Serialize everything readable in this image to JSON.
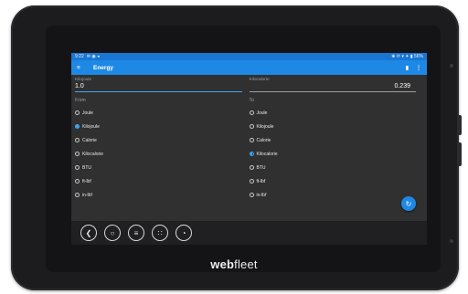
{
  "status": {
    "time": "9:22",
    "left_icons": "✉ ◉ ◂",
    "right_icons": "❀ ⟳ ▾ ✦ ▮ 56%"
  },
  "appbar": {
    "title": "Energy",
    "menu_icon": "≡",
    "action1_icon": "▮",
    "action2_icon": "⋮"
  },
  "input": {
    "unit": "Kilojoule",
    "value": "1.0"
  },
  "output": {
    "unit": "Kilocalorie",
    "value": "0.239"
  },
  "from": {
    "label": "From",
    "options": [
      "Joule",
      "Kilojoule",
      "Calorie",
      "Kilocalorie",
      "BTU",
      "ft-lbf",
      "in-lbf"
    ],
    "selected": "Kilojoule"
  },
  "to": {
    "label": "To",
    "options": [
      "Joule",
      "Kilojoule",
      "Calorie",
      "Kilocalorie",
      "BTU",
      "ft-lbf",
      "in-lbf"
    ],
    "selected": "Kilocalorie"
  },
  "fab_icon": "↻",
  "navbar": {
    "back": "❮",
    "home": "○",
    "menu": "≡",
    "apps": "∷",
    "globe": "◔"
  },
  "brand": {
    "part1": "web",
    "part2": "fleet"
  },
  "colors": {
    "accent": "#1e88e5",
    "background": "#303030"
  }
}
